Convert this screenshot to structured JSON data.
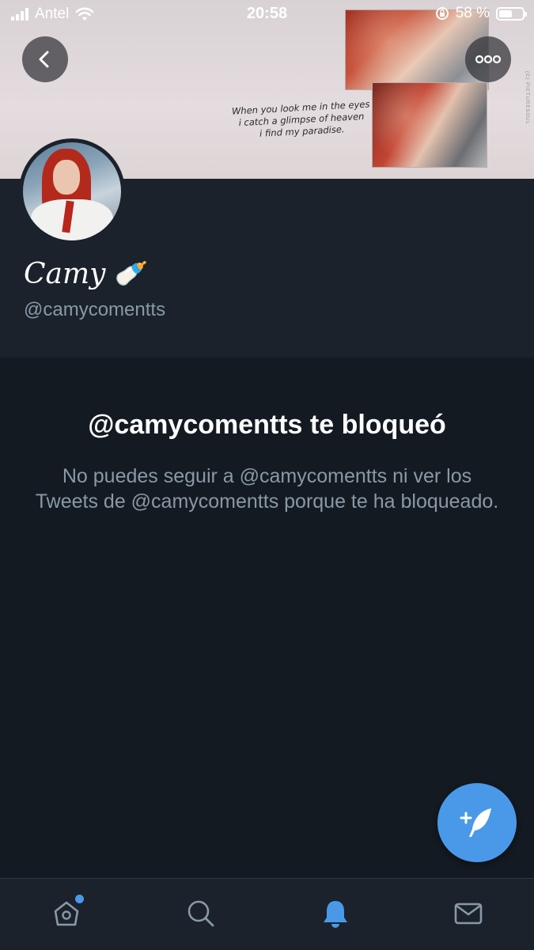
{
  "status_bar": {
    "carrier": "Antel",
    "time": "20:58",
    "battery_percent": "58 %",
    "battery_level": 0.58
  },
  "banner": {
    "quote_lines": [
      "When you look me in the eyes",
      "i catch a glimpse of heaven",
      "i find my paradise."
    ],
    "watermark": "(C) PICTURESOUL"
  },
  "profile": {
    "display_name": "Camy",
    "name_emoji": "🍼",
    "handle": "@camycomentts"
  },
  "blocked": {
    "title": "@camycomentts te bloqueó",
    "description": "No puedes seguir a @camycomentts ni ver los Tweets de @camycomentts porque te ha bloqueado."
  },
  "tabs": [
    {
      "name": "home",
      "icon": "home-icon",
      "has_notification_dot": true
    },
    {
      "name": "search",
      "icon": "search-icon"
    },
    {
      "name": "notifications",
      "icon": "bell-icon",
      "active": true
    },
    {
      "name": "messages",
      "icon": "mail-icon"
    }
  ],
  "colors": {
    "accent": "#4a99e9",
    "background": "#141a21",
    "surface": "#1b222c",
    "secondary_text": "#8899a6"
  }
}
